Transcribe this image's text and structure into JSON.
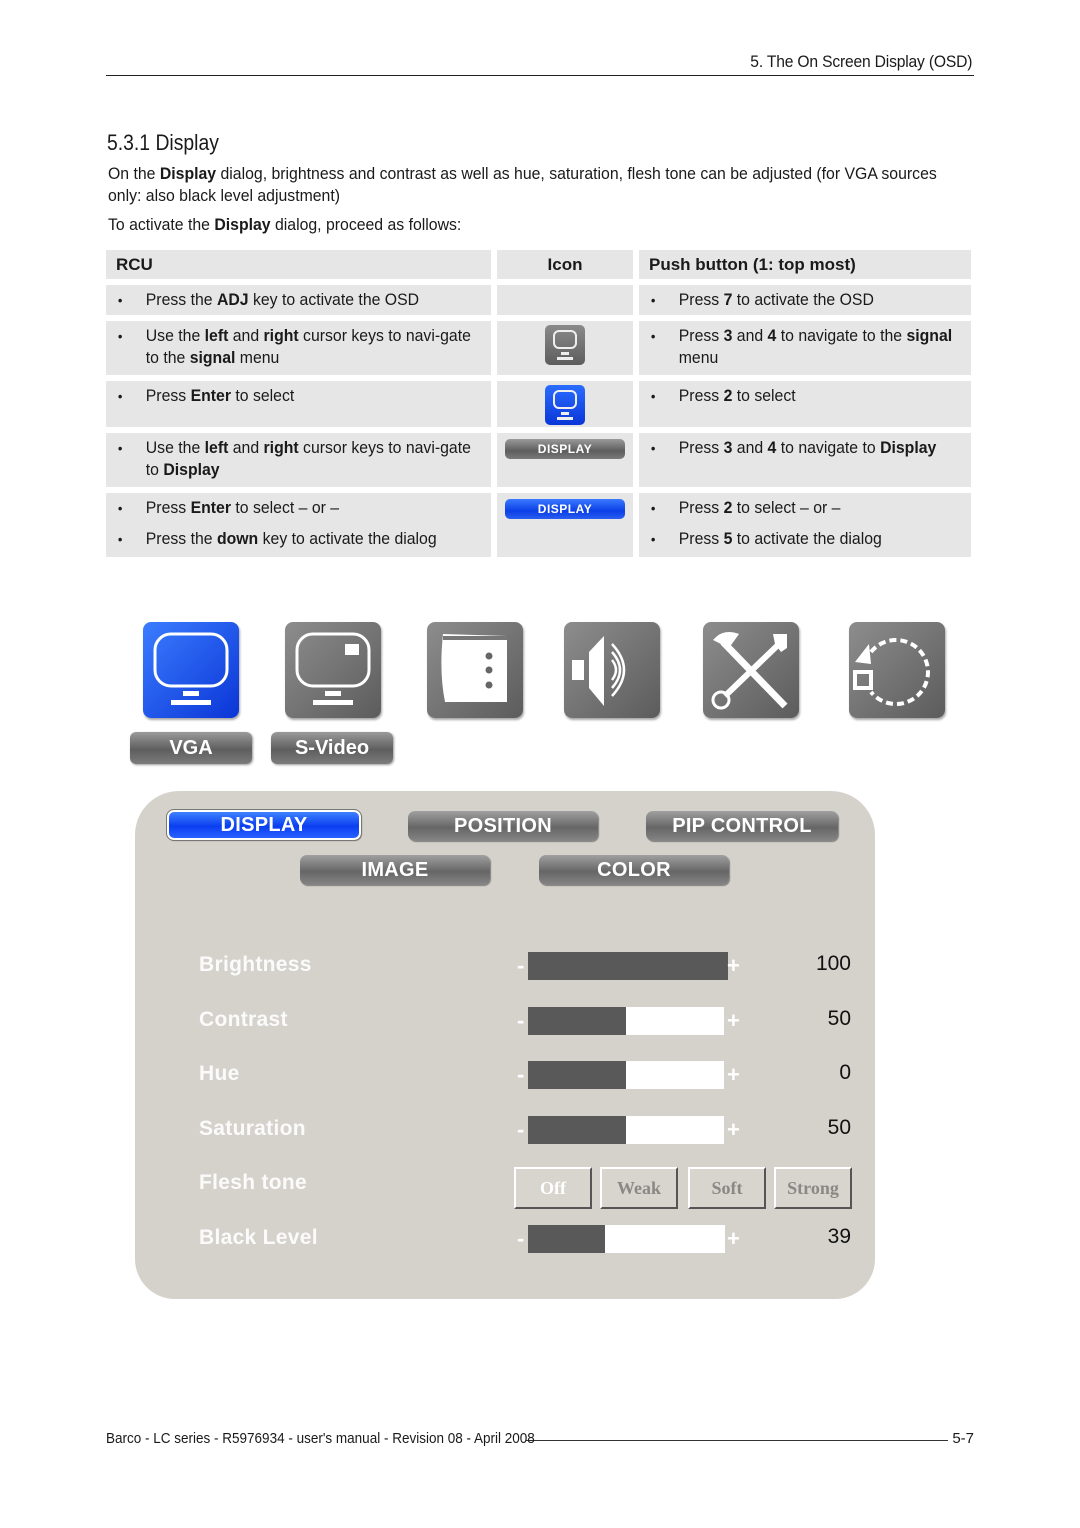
{
  "header": {
    "chapter": "5. The On Screen Display (OSD)"
  },
  "section": {
    "title": "5.3.1 Display",
    "intro_parts": [
      "On the ",
      "Display",
      " dialog, brightness and contrast as well as hue, saturation, flesh tone can be adjusted (for VGA sources only: also black level adjustment)"
    ],
    "activate_parts": [
      "To activate the ",
      "Display",
      " dialog, proceed as follows:"
    ]
  },
  "table": {
    "headers": {
      "rcu": "RCU",
      "icon": "Icon",
      "push": "Push button (1: top most)"
    },
    "rows": [
      {
        "rcu": [
          [
            "Press the ",
            "ADJ",
            " key to activate the OSD"
          ]
        ],
        "icon": "none",
        "push": [
          [
            "Press ",
            "7",
            " to activate the OSD"
          ]
        ]
      },
      {
        "rcu": [
          [
            "Use the ",
            "left",
            " and ",
            "right",
            " cursor keys to navi-gate to the ",
            "signal",
            " menu"
          ]
        ],
        "icon": "monitor-gray-icon",
        "push": [
          [
            "Press ",
            "3",
            " and ",
            "4",
            " to navigate to the ",
            "signal",
            " menu"
          ]
        ]
      },
      {
        "rcu": [
          [
            "Press ",
            "Enter",
            " to select"
          ]
        ],
        "icon": "monitor-blue-icon",
        "push": [
          [
            "Press ",
            "2",
            " to select"
          ]
        ]
      },
      {
        "rcu": [
          [
            "Use the ",
            "left",
            " and ",
            "right",
            " cursor keys to navi-gate to ",
            "Display"
          ]
        ],
        "icon": "display-pill-gray",
        "icon_label": "DISPLAY",
        "push": [
          [
            "Press ",
            "3",
            " and ",
            "4",
            " to navigate to ",
            "Display"
          ]
        ]
      },
      {
        "rcu": [
          [
            "Press ",
            "Enter",
            " to select – or –"
          ],
          [
            "Press the ",
            "down",
            " key to activate the dialog"
          ]
        ],
        "icon": "display-pill-blue",
        "icon_label": "DISPLAY",
        "push": [
          [
            "Press ",
            "2",
            " to select – or –"
          ],
          [
            "Press ",
            "5",
            " to activate the dialog"
          ]
        ]
      }
    ],
    "bullet": "•"
  },
  "osd_icons": {
    "items": [
      "signal-monitor (selected)",
      "video-monitor",
      "pip-window",
      "audio-speaker",
      "tools",
      "rotation"
    ],
    "sources": [
      "VGA",
      "S-Video"
    ]
  },
  "osd_panel": {
    "tabs": [
      "DISPLAY",
      "POSITION",
      "PIP CONTROL",
      "IMAGE",
      "COLOR"
    ],
    "active_tab": "DISPLAY",
    "params": [
      {
        "label": "Brightness",
        "value": "100",
        "fill_percent": 100
      },
      {
        "label": "Contrast",
        "value": "50",
        "fill_percent": 50
      },
      {
        "label": "Hue",
        "value": "0",
        "fill_percent": 50
      },
      {
        "label": "Saturation",
        "value": "50",
        "fill_percent": 50
      },
      {
        "label": "Black Level",
        "value": "39",
        "fill_percent": 39
      }
    ],
    "flesh_tone": {
      "label": "Flesh tone",
      "options": [
        "Off",
        "Weak",
        "Soft",
        "Strong"
      ],
      "selected": "Off"
    },
    "minus": "-",
    "plus": "+"
  },
  "colors": {
    "osd_blue": "#0b3fe6",
    "osd_gray": "#666666",
    "panel_bg": "#d5d2cc",
    "table_bg": "#e6e6e6"
  },
  "footer": {
    "text": "Barco - LC series - R5976934 - user's manual - Revision 08 - April 2008",
    "page": "5-7"
  }
}
